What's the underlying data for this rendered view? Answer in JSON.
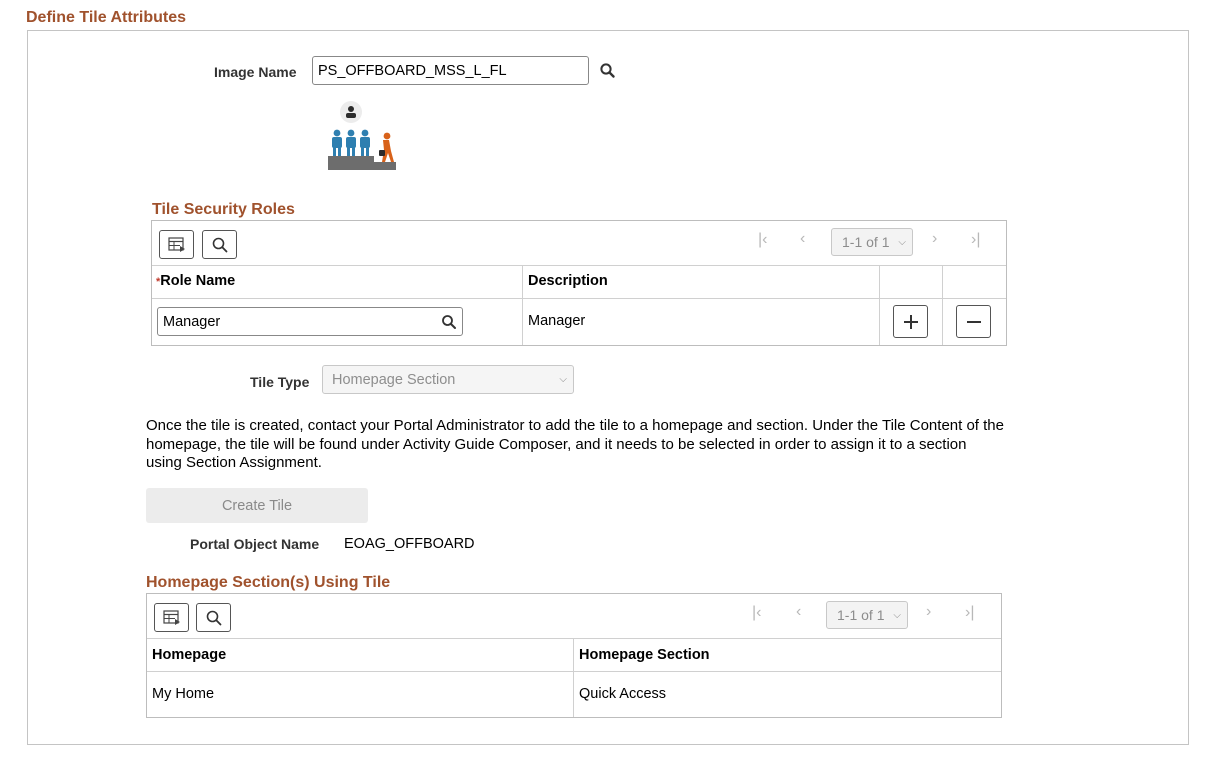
{
  "page": {
    "section_title": "Define Tile Attributes"
  },
  "image": {
    "label": "Image Name",
    "value": "PS_OFFBOARD_MSS_L_FL",
    "icon_name": "offboarding-tile-image"
  },
  "security_roles": {
    "title": "Tile Security Roles",
    "pager": "1-1 of 1",
    "columns": {
      "role_required": "*",
      "role": "Role Name",
      "description": "Description"
    },
    "rows": [
      {
        "role": "Manager",
        "description": "Manager"
      }
    ]
  },
  "tile_type": {
    "label": "Tile Type",
    "value": "Homepage Section"
  },
  "info_text": "Once the tile is created, contact your Portal Administrator to add the tile to a homepage and section. Under the Tile Content of the homepage, the tile will be found under Activity Guide Composer, and it needs to be selected in order to assign it to a section using Section Assignment.",
  "create_tile_label": "Create Tile",
  "portal_object": {
    "label": "Portal Object Name",
    "value": "EOAG_OFFBOARD"
  },
  "homepage_sections": {
    "title": "Homepage Section(s) Using Tile",
    "pager": "1-1 of 1",
    "columns": {
      "homepage": "Homepage",
      "section": "Homepage Section"
    },
    "rows": [
      {
        "homepage": "My Home",
        "section": "Quick Access"
      }
    ]
  },
  "colors": {
    "section_title": "#a0522d",
    "figure_blue": "#2e7fb0",
    "figure_orange": "#d8621a",
    "base_gray": "#6d6d6d"
  }
}
